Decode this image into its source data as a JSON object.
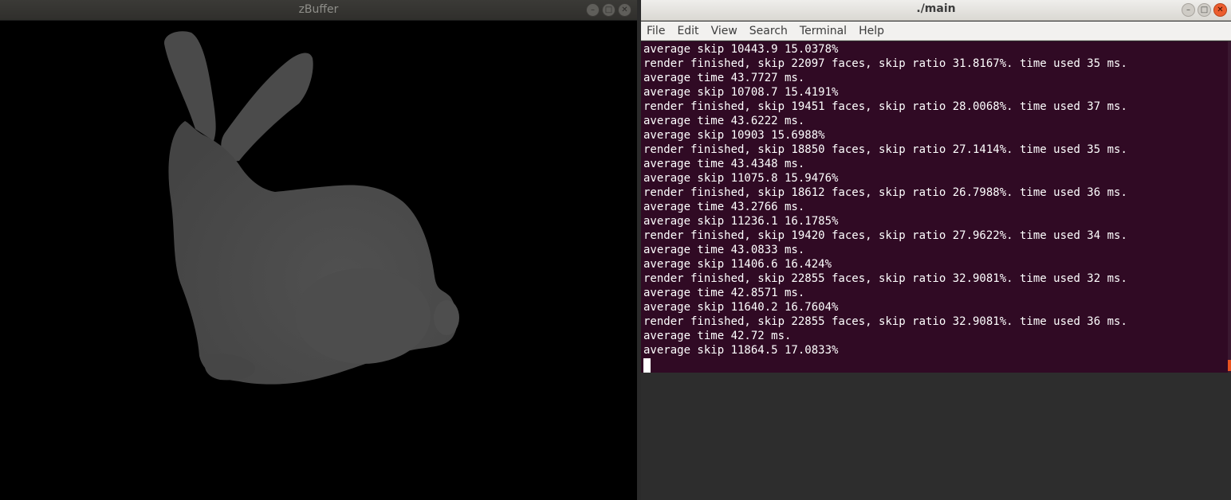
{
  "zbuffer": {
    "title": "zBuffer",
    "controls": {
      "minimize_icon": "minimize-icon",
      "maximize_icon": "maximize-icon",
      "close_icon": "close-icon"
    },
    "canvas_bg": "#000000",
    "model_color": "#4a4a4a"
  },
  "terminal": {
    "title": "./main",
    "menu": [
      "File",
      "Edit",
      "View",
      "Search",
      "Terminal",
      "Help"
    ],
    "bg_color": "#300a24",
    "text_color": "#ffffff",
    "accent_color": "#e95420",
    "lines": [
      "average skip 10443.9 15.0378%",
      "render finished, skip 22097 faces, skip ratio 31.8167%. time used 35 ms.",
      "average time 43.7727 ms.",
      "average skip 10708.7 15.4191%",
      "render finished, skip 19451 faces, skip ratio 28.0068%. time used 37 ms.",
      "average time 43.6222 ms.",
      "average skip 10903 15.6988%",
      "render finished, skip 18850 faces, skip ratio 27.1414%. time used 35 ms.",
      "average time 43.4348 ms.",
      "average skip 11075.8 15.9476%",
      "render finished, skip 18612 faces, skip ratio 26.7988%. time used 36 ms.",
      "average time 43.2766 ms.",
      "average skip 11236.1 16.1785%",
      "render finished, skip 19420 faces, skip ratio 27.9622%. time used 34 ms.",
      "average time 43.0833 ms.",
      "average skip 11406.6 16.424%",
      "render finished, skip 22855 faces, skip ratio 32.9081%. time used 32 ms.",
      "average time 42.8571 ms.",
      "average skip 11640.2 16.7604%",
      "render finished, skip 22855 faces, skip ratio 32.9081%. time used 36 ms.",
      "average time 42.72 ms.",
      "average skip 11864.5 17.0833%"
    ]
  }
}
